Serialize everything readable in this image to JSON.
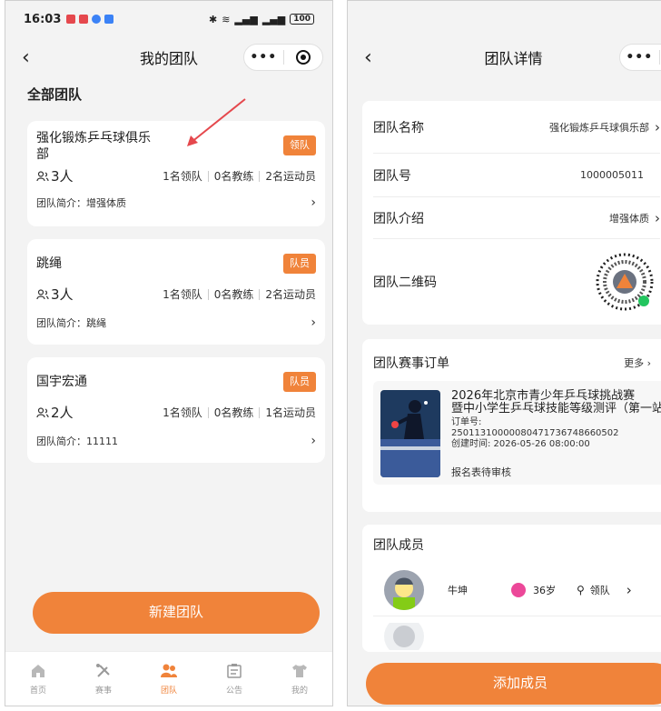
{
  "left": {
    "status": {
      "time": "16:03",
      "battery": "100"
    },
    "nav": {
      "title": "我的团队"
    },
    "section_title": "全部团队",
    "teams": [
      {
        "name": "强化锻炼乒乓球俱乐部",
        "role": "领队",
        "members": "3人",
        "leaders": "1名领队",
        "coaches": "0名教练",
        "athletes": "2名运动员",
        "intro": "团队简介：增强体质"
      },
      {
        "name": "跳绳",
        "role": "队员",
        "members": "3人",
        "leaders": "1名领队",
        "coaches": "0名教练",
        "athletes": "2名运动员",
        "intro": "团队简介：跳绳"
      },
      {
        "name": "国宇宏通",
        "role": "队员",
        "members": "2人",
        "leaders": "1名领队",
        "coaches": "0名教练",
        "athletes": "1名运动员",
        "intro": "团队简介：11111"
      }
    ],
    "new_team_label": "新建团队",
    "tabs": [
      {
        "label": "首页",
        "icon": "home-icon"
      },
      {
        "label": "赛事",
        "icon": "racket-icon"
      },
      {
        "label": "团队",
        "icon": "team-icon"
      },
      {
        "label": "公告",
        "icon": "notice-icon"
      },
      {
        "label": "我的",
        "icon": "shirt-icon"
      }
    ]
  },
  "right": {
    "nav": {
      "title": "团队详情"
    },
    "info": {
      "name_label": "团队名称",
      "name_value": "强化锻炼乒乓球俱乐部",
      "id_label": "团队号",
      "id_value": "1000005011",
      "intro_label": "团队介绍",
      "intro_value": "增强体质",
      "qr_label": "团队二维码"
    },
    "orders": {
      "title": "团队赛事订单",
      "more": "更多",
      "item": {
        "title_line1": "2026年北京市青少年乒乓球挑战赛",
        "title_line2": "暨中小学生乒乓球技能等级测评（第一站",
        "order_no_label": "订单号:",
        "order_no": "25011310000080471736748660502",
        "created": "创建时间: 2026-05-26 08:00:00",
        "status": "报名表待审核"
      }
    },
    "members": {
      "title": "团队成员",
      "list": [
        {
          "name": "牛坤",
          "age": "36岁",
          "role": "领队"
        }
      ]
    },
    "add_member_label": "添加成员"
  },
  "colors": {
    "accent": "#f0833a",
    "arrow": "#e5484d"
  }
}
